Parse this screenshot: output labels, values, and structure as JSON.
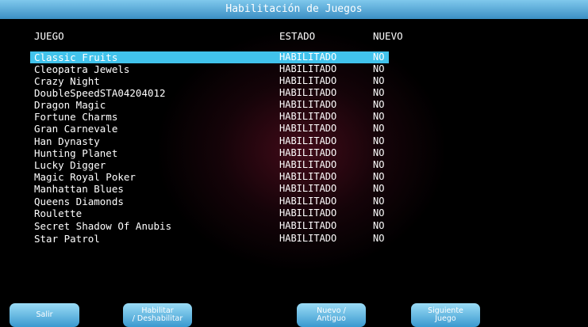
{
  "window": {
    "title": "Habilitación de Juegos"
  },
  "table": {
    "headers": {
      "game": "JUEGO",
      "state": "ESTADO",
      "new": "NUEVO"
    },
    "rows": [
      {
        "name": "Classic Fruits",
        "state": "HABILITADO",
        "new": "NO"
      },
      {
        "name": "Cleopatra Jewels",
        "state": "HABILITADO",
        "new": "NO"
      },
      {
        "name": "Crazy Night",
        "state": "HABILITADO",
        "new": "NO"
      },
      {
        "name": "DoubleSpeedSTA04204012",
        "state": "HABILITADO",
        "new": "NO"
      },
      {
        "name": "Dragon Magic",
        "state": "HABILITADO",
        "new": "NO"
      },
      {
        "name": "Fortune Charms",
        "state": "HABILITADO",
        "new": "NO"
      },
      {
        "name": "Gran Carnevale",
        "state": "HABILITADO",
        "new": "NO"
      },
      {
        "name": "Han Dynasty",
        "state": "HABILITADO",
        "new": "NO"
      },
      {
        "name": "Hunting Planet",
        "state": "HABILITADO",
        "new": "NO"
      },
      {
        "name": "Lucky Digger",
        "state": "HABILITADO",
        "new": "NO"
      },
      {
        "name": "Magic Royal Poker",
        "state": "HABILITADO",
        "new": "NO"
      },
      {
        "name": "Manhattan Blues",
        "state": "HABILITADO",
        "new": "NO"
      },
      {
        "name": "Queens Diamonds",
        "state": "HABILITADO",
        "new": "NO"
      },
      {
        "name": "Roulette",
        "state": "HABILITADO",
        "new": "NO"
      },
      {
        "name": "Secret Shadow Of Anubis",
        "state": "HABILITADO",
        "new": "NO"
      },
      {
        "name": "Star Patrol",
        "state": "HABILITADO",
        "new": "NO"
      }
    ]
  },
  "buttons": {
    "exit": {
      "line1": "Salir"
    },
    "toggle": {
      "line1": "Habilitar",
      "line2": "/ Deshabilitar"
    },
    "new_old": {
      "line1": "Nuevo /",
      "line2": "Antiguo"
    },
    "next": {
      "line1": "Siguiente",
      "line2": "Juego"
    }
  },
  "colors": {
    "title_bar": "#5aaedb",
    "selection": "#41c3ec",
    "button": "#5ab6e2",
    "background": "#000000"
  }
}
